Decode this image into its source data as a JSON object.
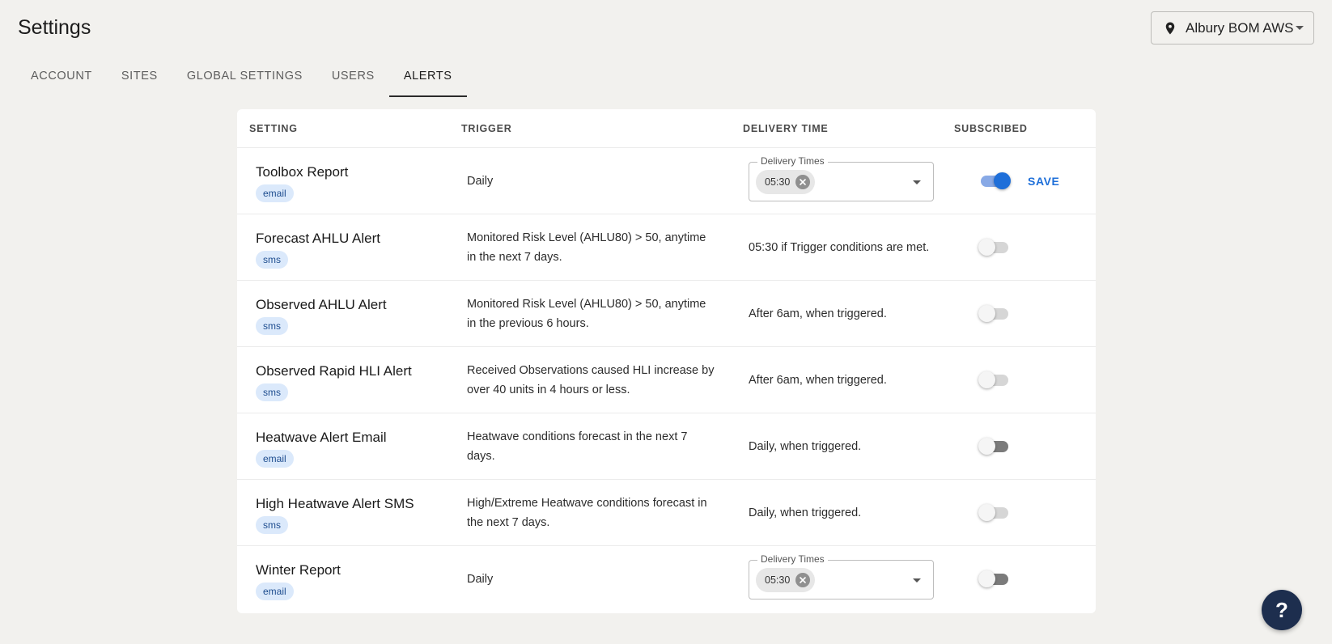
{
  "page": {
    "title": "Settings"
  },
  "site_selector": {
    "label": "Albury BOM AWS",
    "icon": "location-pin-icon"
  },
  "tabs": [
    {
      "label": "ACCOUNT",
      "active": false
    },
    {
      "label": "SITES",
      "active": false
    },
    {
      "label": "GLOBAL SETTINGS",
      "active": false
    },
    {
      "label": "USERS",
      "active": false
    },
    {
      "label": "ALERTS",
      "active": true
    }
  ],
  "table": {
    "headers": {
      "setting": "SETTING",
      "trigger": "TRIGGER",
      "delivery": "DELIVERY TIME",
      "subscribed": "SUBSCRIBED"
    },
    "rows": [
      {
        "name": "Toolbox Report",
        "channel": "email",
        "trigger": "Daily",
        "delivery_label": "Delivery Times",
        "delivery_chip": "05:30",
        "subscribed": true,
        "save_label": "SAVE"
      },
      {
        "name": "Forecast AHLU Alert",
        "channel": "sms",
        "trigger": "Monitored Risk Level (AHLU80) > 50, anytime in the next 7 days.",
        "delivery": "05:30 if Trigger conditions are met.",
        "subscribed": false
      },
      {
        "name": "Observed AHLU Alert",
        "channel": "sms",
        "trigger": "Monitored Risk Level (AHLU80) > 50, anytime in the previous 6 hours.",
        "delivery": "After 6am, when triggered.",
        "subscribed": false
      },
      {
        "name": "Observed Rapid HLI Alert",
        "channel": "sms",
        "trigger": "Received Observations caused HLI increase by over 40 units in 4 hours or less.",
        "delivery": "After 6am, when triggered.",
        "subscribed": false
      },
      {
        "name": "Heatwave Alert Email",
        "channel": "email",
        "trigger": "Heatwave conditions forecast in the next 7 days.",
        "delivery": "Daily, when triggered.",
        "subscribed": false
      },
      {
        "name": "High Heatwave Alert SMS",
        "channel": "sms",
        "trigger": "High/Extreme Heatwave conditions forecast in the next 7 days.",
        "delivery": "Daily, when triggered.",
        "subscribed": false
      },
      {
        "name": "Winter Report",
        "channel": "email",
        "trigger": "Daily",
        "delivery_label": "Delivery Times",
        "delivery_chip": "05:30",
        "subscribed": false
      }
    ]
  },
  "help": {
    "label": "?"
  },
  "colors": {
    "accent": "#1e6fd9",
    "help_button": "#1d2e4e",
    "tag_bg": "#dbe9fb"
  }
}
